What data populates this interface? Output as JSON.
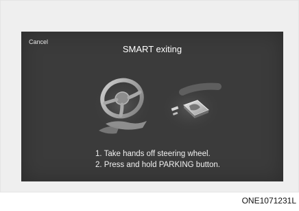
{
  "screen": {
    "cancel_label": "Cancel",
    "title": "SMART exiting",
    "instructions": [
      "1. Take hands off steering wheel.",
      "2. Press and hold PARKING button."
    ]
  },
  "figure_code": "ONE1071231L",
  "illustration": {
    "steering_wheel_icon": "steering-wheel-with-hand",
    "parking_button_icon": "hand-pressing-parking-button"
  }
}
